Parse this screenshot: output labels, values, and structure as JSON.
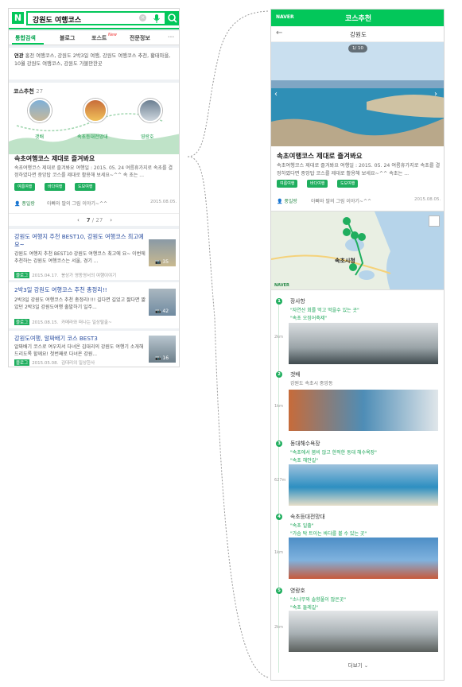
{
  "left": {
    "search": {
      "query": "강원도 여행코스",
      "logo": "N"
    },
    "tabs": [
      {
        "label": "통합검색"
      },
      {
        "label": "블로그"
      },
      {
        "label": "포스트"
      },
      {
        "label": "전문정보"
      }
    ],
    "post_badge": "New",
    "related": {
      "label": "연관",
      "text": "홍천 여행코스, 강원도 2박3일 여행, 강원도 여행코스 추천, 황태마을, 10월 강원도 여행코스, 강원도 가볼만한곳"
    },
    "course": {
      "title": "코스추천",
      "count": "27",
      "pins": [
        "갯배",
        "속초등대전망대",
        "영랑호"
      ],
      "name": "속초여행코스 제대로 즐겨봐요",
      "desc": "속초여행코스 제대로 즐겨봐요 여행일 : 2015. 05. 24 여름휴가지로 속초를 결정하였다면 중앙탑 코스를 제대로 활용해 보세요~^^ 속 초는 ...",
      "tags": [
        "여름여행",
        "바다여행",
        "도보여행"
      ],
      "user": "풍일랑",
      "user_text": "아빠와 딸의 그림 이야기~^^",
      "date": "2015.08.05.",
      "page": "7",
      "total": "/ 27"
    },
    "cards": [
      {
        "title": "강원도 여행지 추천 BEST10, 강원도 여행코스 최고예요~",
        "body": "강원도 여행지 추천 BEST10 강원도 여행코스 최고에 요~ 이번에 추천하는 강원도 여행코스는 서울, 경기 ...",
        "tag": "블로그",
        "date": "2015.04.17.",
        "author": "봉상가 영동영서의 여행이야기",
        "thumb_count": "35"
      },
      {
        "title": "2박3일 강원도 여행코스 추천 총정리!!",
        "body": "2박3일 강원도 여행코스 추천 총정리!!!! 길다면 길었고 짧다면 짧았던 2박3일 강원도여행 출발하기 일주...",
        "tag": "블로그",
        "date": "2015.08.15.",
        "author": "카메라와 떠나는 일상탈출~",
        "thumb_count": "42"
      },
      {
        "title": "강원도여행, 알짜배기 코스 BEST3",
        "body": "알짜배기 코스로 여우지서 다녀온 김대리의 강원도 여행기 소개해드리도록 할께요! 첫번째로 다녀온 강원...",
        "tag": "블로그",
        "date": "2015.05.08.",
        "author": "김대리의 일상한사",
        "thumb_count": "16"
      }
    ]
  },
  "right": {
    "logo": "NAVER",
    "header_title": "코스추천",
    "sub_title": "강원도",
    "photo_counter": "1/ 10",
    "name": "속초여행코스 제대로 즐겨봐요",
    "desc": "속초여행코스 제대로 즐겨봐요 여행일 : 2015. 05. 24 여름휴가지로 속초를 결정하였다면 중앙탑 코스를 제대로 활용해 보세요~^^ 속초는 ...",
    "tags": [
      "여름여행",
      "바다여행",
      "도보여행"
    ],
    "user": "풍일랑",
    "user_text": "아빠와 딸의 그림 이야기~^^",
    "date": "2015.08.05.",
    "map_label": "속초시청",
    "map_naver": "NAVER",
    "stops": [
      {
        "num": "1",
        "name": "장사항",
        "quotes": [
          "\"자연산 회를 먹고 먹을수 있는 곳\"",
          "\"속초 오징어축제\""
        ],
        "dist": "2km"
      },
      {
        "num": "2",
        "name": "갯배",
        "quotes": [
          "강원도 속초시 중앙동"
        ],
        "dist": "1km"
      },
      {
        "num": "3",
        "name": "동대해수욕장",
        "quotes": [
          "\"속초에서 붐비 않고 한적한 동대 해수욕장\"",
          "\"속초 해안길\""
        ],
        "dist": "627m"
      },
      {
        "num": "4",
        "name": "속초등대전망대",
        "quotes": [
          "\"속초 일출\"",
          "\"가슴 탁 트이는 바다를 볼 수 있는 곳\""
        ],
        "dist": "1km"
      },
      {
        "num": "5",
        "name": "영랑호",
        "quotes": [
          "\"소나무와 솔향풀이 많은곳\"",
          "\"속초 둘레길\""
        ],
        "dist": "2km"
      }
    ],
    "more": "더보기"
  },
  "colors": {
    "brand": "#03c75a",
    "tag": "#1fae5e",
    "link": "#2a4ea0"
  }
}
